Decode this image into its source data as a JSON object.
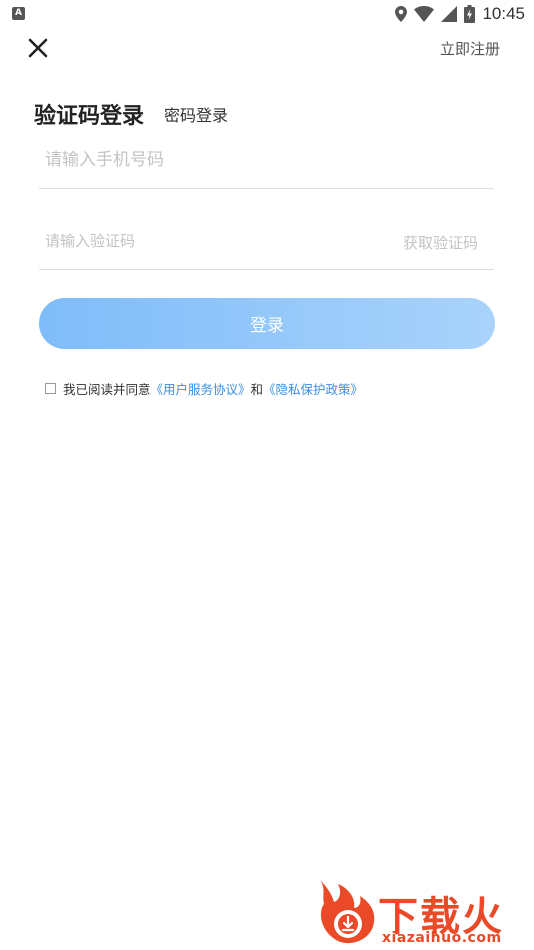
{
  "status_bar": {
    "app_icon_letter": "A",
    "time": "10:45"
  },
  "header": {
    "register_label": "立即注册"
  },
  "tabs": {
    "active_label": "验证码登录",
    "inactive_label": "密码登录"
  },
  "form": {
    "phone_placeholder": "请输入手机号码",
    "phone_value": "",
    "code_placeholder": "请输入验证码",
    "code_value": "",
    "get_code_label": "获取验证码",
    "login_label": "登录"
  },
  "agreement": {
    "prefix": "我已阅读并同意",
    "user_agreement": "《用户服务协议》",
    "conjunction": "和",
    "privacy_policy": "《隐私保护政策》"
  },
  "watermark": {
    "brand": "下载火",
    "domain": "xiazaihuo.com"
  },
  "colors": {
    "accent": "#3b8ee8",
    "button_start": "#7fbcf9",
    "button_end": "#a9d3fb",
    "watermark": "#ea4a28"
  }
}
